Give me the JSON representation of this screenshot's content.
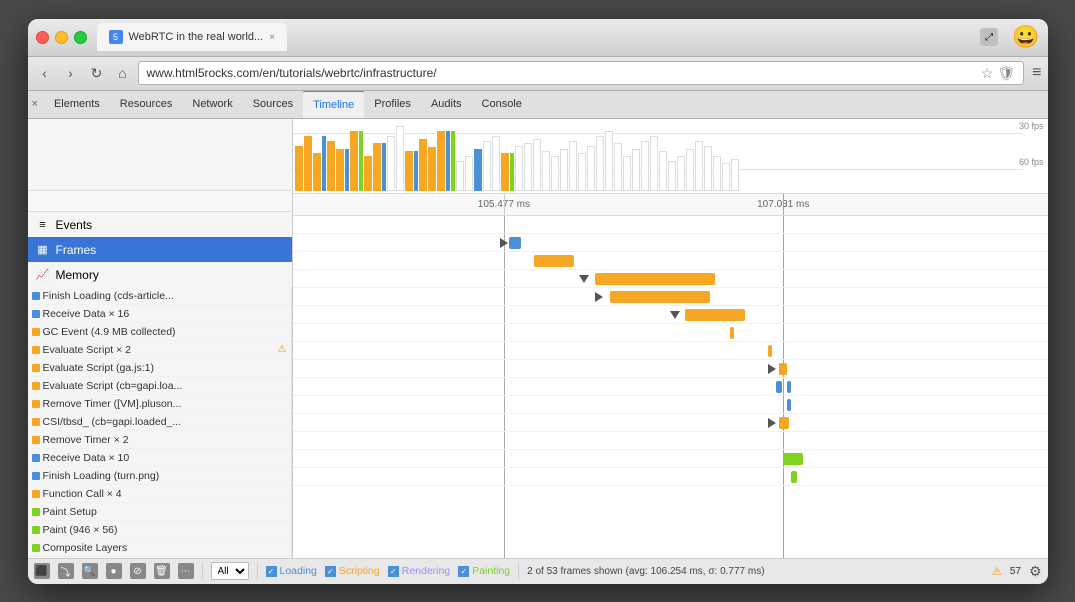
{
  "browser": {
    "tab_title": "WebRTC in the real world...",
    "tab_close": "×",
    "url": "www.html5rocks.com/en/tutorials/webrtc/infrastructure/",
    "emoji": "😀"
  },
  "nav": {
    "back": "‹",
    "forward": "›",
    "refresh": "↻",
    "home": "⌂",
    "star": "☆",
    "shield": "🛡",
    "menu": "≡"
  },
  "devtools": {
    "close": "×",
    "tabs": [
      "Elements",
      "Resources",
      "Network",
      "Sources",
      "Timeline",
      "Profiles",
      "Audits",
      "Console"
    ],
    "active_tab": "Timeline"
  },
  "sidebar": {
    "items": [
      {
        "id": "events",
        "label": "Events",
        "icon": "≡"
      },
      {
        "id": "frames",
        "label": "Frames",
        "icon": "▦",
        "active": true
      },
      {
        "id": "memory",
        "label": "Memory",
        "icon": "📈"
      }
    ]
  },
  "fps": {
    "label_30": "30 fps",
    "label_60": "60 fps"
  },
  "timeline": {
    "markers": [
      {
        "label": "105.477 ms",
        "pos_pct": 28
      },
      {
        "label": "107.031 ms",
        "pos_pct": 65
      }
    ]
  },
  "events": [
    {
      "id": "finish-loading-cds",
      "color": "#4a90d9",
      "text": "Finish Loading (cds-article...",
      "warn": false
    },
    {
      "id": "receive-data-16",
      "color": "#4a90d9",
      "text": "Receive Data × 16",
      "warn": false
    },
    {
      "id": "gc-event",
      "color": "#f5a623",
      "text": "GC Event (4.9 MB collected)",
      "warn": false
    },
    {
      "id": "evaluate-script-2",
      "color": "#f5a623",
      "text": "Evaluate Script × 2",
      "warn": true
    },
    {
      "id": "evaluate-script-ga",
      "color": "#f5a623",
      "text": "Evaluate Script (ga.js:1)",
      "warn": false
    },
    {
      "id": "evaluate-script-cb",
      "color": "#f5a623",
      "text": "Evaluate Script (cb=gapi.loa...",
      "warn": false
    },
    {
      "id": "remove-timer-vm",
      "color": "#f5a623",
      "text": "Remove Timer ([VM].pluson...",
      "warn": false
    },
    {
      "id": "csi-tbsd",
      "color": "#f5a623",
      "text": "CSI/tbsd_ (cb=gapi.loaded_...",
      "warn": false
    },
    {
      "id": "remove-timer-2",
      "color": "#f5a623",
      "text": "Remove Timer × 2",
      "warn": false
    },
    {
      "id": "receive-data-10",
      "color": "#4a90d9",
      "text": "Receive Data × 10",
      "warn": false
    },
    {
      "id": "finish-loading-turn",
      "color": "#4a90d9",
      "text": "Finish Loading (turn.png)",
      "warn": false
    },
    {
      "id": "function-call-4",
      "color": "#f5a623",
      "text": "Function Call × 4",
      "warn": false
    },
    {
      "id": "paint-setup",
      "color": "#7ed321",
      "text": "Paint Setup",
      "warn": false
    },
    {
      "id": "paint-946",
      "color": "#7ed321",
      "text": "Paint (946 × 56)",
      "warn": false
    },
    {
      "id": "composite-layers",
      "color": "#7ed321",
      "text": "Composite Layers",
      "warn": false
    }
  ],
  "bottom_toolbar": {
    "filter_all": "All",
    "filters": [
      {
        "id": "loading",
        "label": "Loading",
        "checked": true,
        "color": "#4a90d9"
      },
      {
        "id": "scripting",
        "label": "Scripting",
        "checked": true,
        "color": "#f5a623"
      },
      {
        "id": "rendering",
        "label": "Rendering",
        "checked": true,
        "color": "#a78bfa"
      },
      {
        "id": "painting",
        "label": "Painting",
        "checked": true,
        "color": "#7ed321"
      }
    ],
    "status": "2 of 53 frames shown (avg: 106.254 ms, σ: 0.777 ms)",
    "warn_count": "57"
  }
}
